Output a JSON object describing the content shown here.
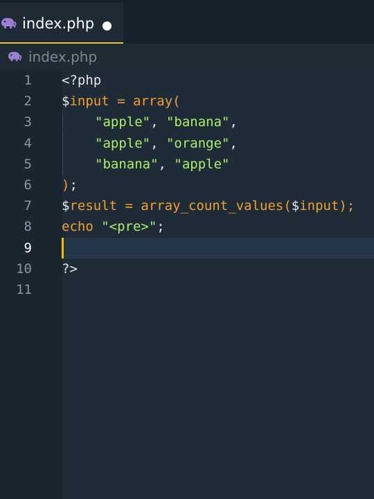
{
  "tab": {
    "label": "index.php",
    "icon": "elephant-icon",
    "modified": true
  },
  "breadcrumb": {
    "label": "index.php",
    "icon": "elephant-icon"
  },
  "colors": {
    "accent": "#e8c040",
    "string": "#a8f06a",
    "keyword": "#f0a030",
    "background": "#1f2a35"
  },
  "editor": {
    "active_line": 9,
    "lines": [
      {
        "num": "1",
        "tokens": [
          {
            "t": "<?php",
            "c": "plain"
          }
        ]
      },
      {
        "num": "2",
        "tokens": [
          {
            "t": "$",
            "c": "plain"
          },
          {
            "t": "input",
            "c": "var"
          },
          {
            "t": " = ",
            "c": "op"
          },
          {
            "t": "array(",
            "c": "fn"
          }
        ]
      },
      {
        "num": "3",
        "indent": true,
        "tokens": [
          {
            "t": "\"apple\"",
            "c": "str"
          },
          {
            "t": ", ",
            "c": "punc"
          },
          {
            "t": "\"banana\"",
            "c": "str"
          },
          {
            "t": ",",
            "c": "punc"
          }
        ]
      },
      {
        "num": "4",
        "indent": true,
        "tokens": [
          {
            "t": "\"apple\"",
            "c": "str"
          },
          {
            "t": ", ",
            "c": "punc"
          },
          {
            "t": "\"orange\"",
            "c": "str"
          },
          {
            "t": ",",
            "c": "punc"
          }
        ]
      },
      {
        "num": "5",
        "indent": true,
        "tokens": [
          {
            "t": "\"banana\"",
            "c": "str"
          },
          {
            "t": ", ",
            "c": "punc"
          },
          {
            "t": "\"apple\"",
            "c": "str"
          }
        ]
      },
      {
        "num": "6",
        "tokens": [
          {
            "t": ")",
            "c": "fn"
          },
          {
            "t": ";",
            "c": "punc"
          }
        ]
      },
      {
        "num": "7",
        "tokens": [
          {
            "t": "$",
            "c": "plain"
          },
          {
            "t": "result",
            "c": "var"
          },
          {
            "t": " = ",
            "c": "op"
          },
          {
            "t": "array_count_values(",
            "c": "fn"
          },
          {
            "t": "$",
            "c": "plain"
          },
          {
            "t": "input",
            "c": "var"
          },
          {
            "t": ");",
            "c": "fn"
          }
        ]
      },
      {
        "num": "8",
        "tokens": [
          {
            "t": "echo",
            "c": "kw"
          },
          {
            "t": " ",
            "c": "plain"
          },
          {
            "t": "\"<pre>\"",
            "c": "str"
          },
          {
            "t": ";",
            "c": "punc"
          }
        ]
      },
      {
        "num": "9",
        "tokens": []
      },
      {
        "num": "10",
        "tokens": [
          {
            "t": "?>",
            "c": "plain"
          }
        ]
      },
      {
        "num": "11",
        "tokens": []
      }
    ]
  }
}
